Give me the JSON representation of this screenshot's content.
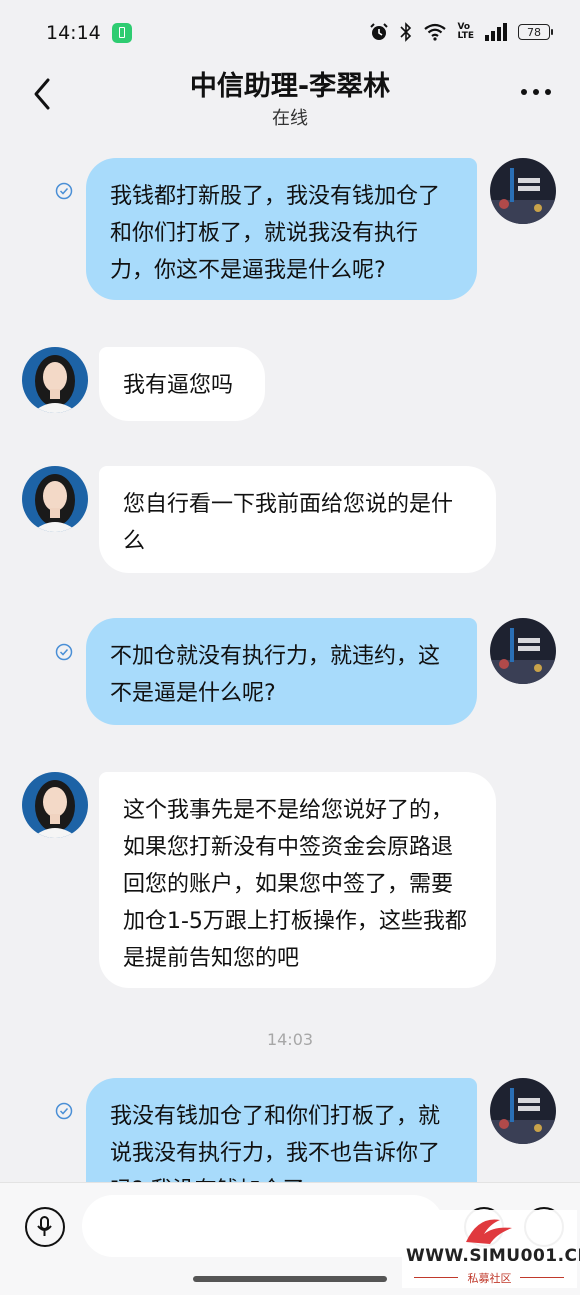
{
  "status_bar": {
    "time": "14:14",
    "battery_level": "78",
    "icons": [
      "alarm-icon",
      "bluetooth-icon",
      "wifi-icon",
      "volte-icon",
      "signal-icon",
      "battery-icon"
    ],
    "volte_label_top": "Vo",
    "volte_label_bottom": "LTE"
  },
  "header": {
    "title": "中信助理-李翠林",
    "subtitle": "在线"
  },
  "messages": [
    {
      "direction": "out",
      "text": "我钱都打新股了，我没有钱加仓了和你们打板了，就说我没有执行力，你这不是逼我是什么呢?"
    },
    {
      "direction": "in",
      "text": "我有逼您吗"
    },
    {
      "direction": "in",
      "text": "您自行看一下我前面给您说的是什么"
    },
    {
      "direction": "out",
      "text": "不加仓就没有执行力，就违约，这不是逼是什么呢?"
    },
    {
      "direction": "in",
      "text": "这个我事先是不是给您说好了的，如果您打新没有中签资金会原路退回您的账户，如果您中签了，需要加仓1-5万跟上打板操作，这些我都是提前告知您的吧"
    },
    {
      "direction": "out",
      "text": "我没有钱加仓了和你们打板了，就说我没有执行力，我不也告诉你了吗?  我没有钱加仓了"
    }
  ],
  "timestamp": "14:03",
  "input": {
    "placeholder": ""
  },
  "watermark": {
    "url": "WWW.SIMU001.CN",
    "subtitle": "私募社区"
  },
  "colors": {
    "outgoing_bubble": "#a8dbfb",
    "incoming_bubble": "#ffffff",
    "background": "#f1f1f3",
    "read_check": "#4a8fd6"
  }
}
